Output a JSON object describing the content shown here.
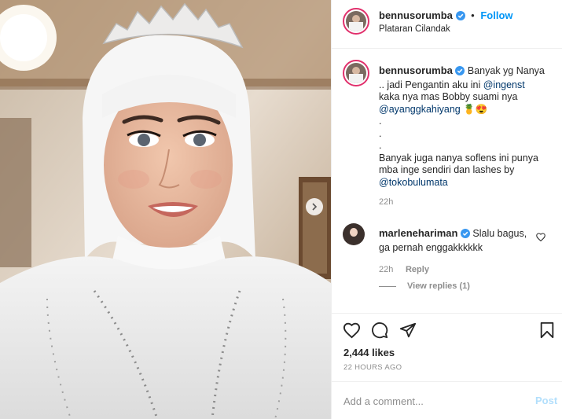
{
  "header": {
    "username": "bennusorumba",
    "follow_label": "Follow",
    "separator": "•",
    "location": "Plataran Cilandak"
  },
  "caption": {
    "username": "bennusorumba",
    "line1_a": "Banyak yg Nanya",
    "line2": ".. jadi Pengantin aku ini ",
    "mention1": "@ingenst",
    "line3": "kaka nya mas Bobby suami nya",
    "mention2": "@ayanggkahiyang",
    "emojis": "🍍😍",
    "dot1": ".",
    "dot2": ".",
    "dot3": ".",
    "line4": "Banyak juga nanya soflens ini punya",
    "line5": "mba inge sendiri dan lashes by",
    "mention3": "@tokobulumata",
    "time": "22h"
  },
  "comment": {
    "username": "marlenehariman",
    "text_a": "Slalu bagus,",
    "text_b": "ga pernah enggakkkkkk",
    "time": "22h",
    "reply_label": "Reply",
    "view_replies": "View replies (1)"
  },
  "likes": "2,444 likes",
  "posted_ago": "22 HOURS AGO",
  "comment_box": {
    "placeholder": "Add a comment...",
    "post_label": "Post"
  },
  "colors": {
    "link_blue": "#0095f6",
    "mention_blue": "#00376b",
    "muted": "#8e8e8e",
    "post_disabled": "#b2dffc",
    "story_ring": "#e1306c"
  },
  "icons": [
    "heart-icon",
    "comment-icon",
    "share-icon",
    "bookmark-icon",
    "verified-badge-icon",
    "chevron-right-icon",
    "small-heart-icon"
  ]
}
